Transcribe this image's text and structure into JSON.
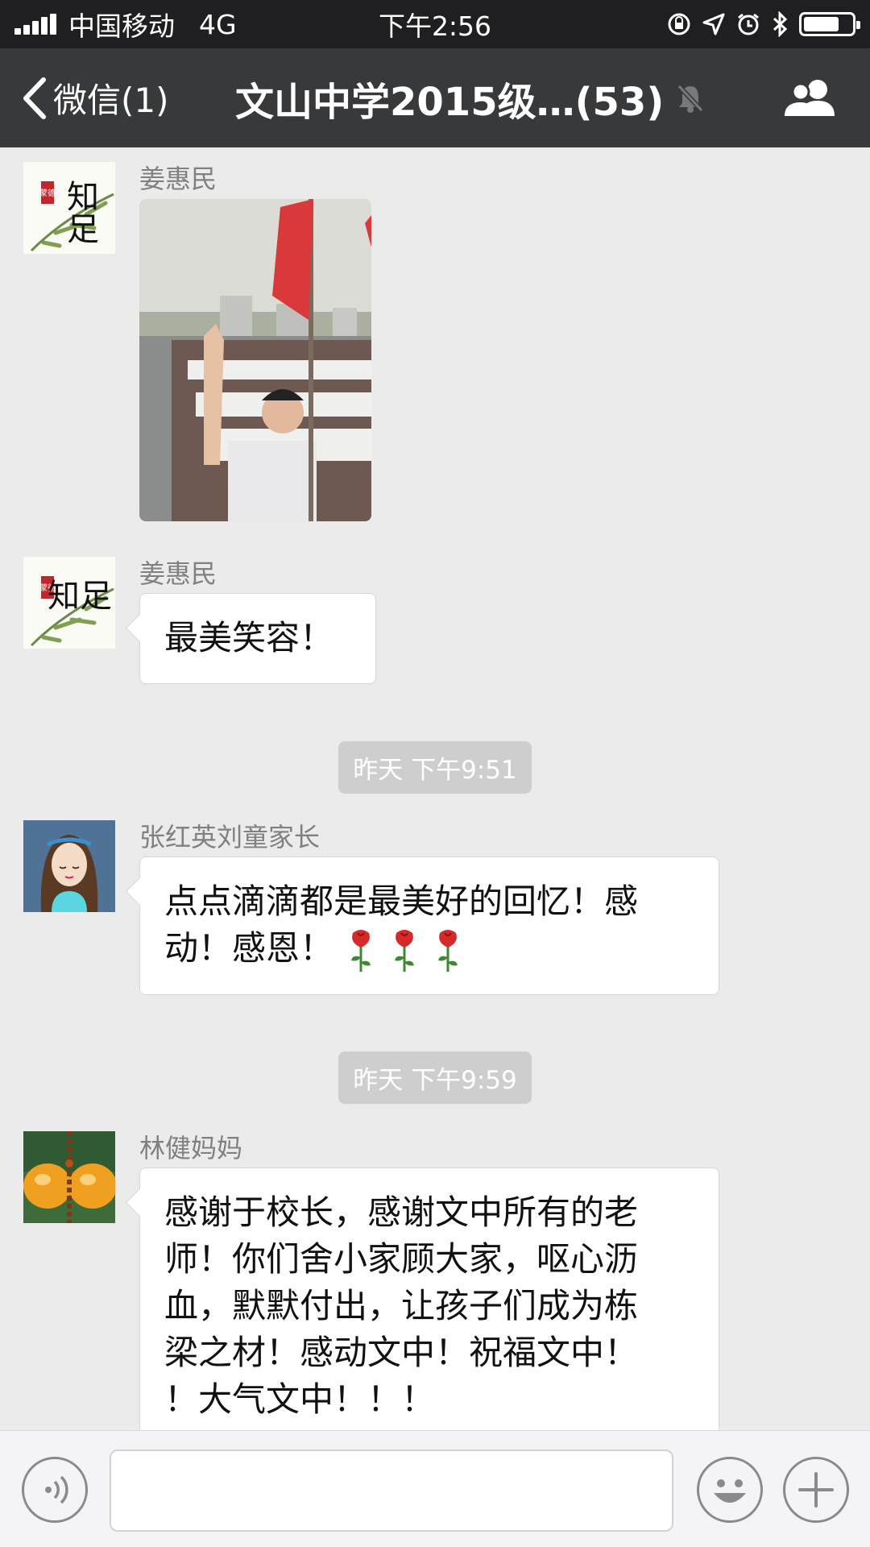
{
  "status_bar": {
    "carrier": "中国移动",
    "network": "4G",
    "time": "下午2:56",
    "icons": [
      "orientation-lock-icon",
      "location-icon",
      "alarm-icon",
      "bluetooth-icon",
      "battery-icon"
    ]
  },
  "nav": {
    "back_label": "微信(1)",
    "title": "文山中学2015级…(53)",
    "icons": [
      "back-chevron-icon",
      "mute-bell-icon",
      "group-members-icon"
    ]
  },
  "messages": [
    {
      "sender": "姜惠民",
      "type": "image",
      "image": "student-thumbs-up-with-red-flag-photo"
    },
    {
      "sender": "姜惠民",
      "type": "text",
      "text": "最美笑容！"
    },
    {
      "type": "timestamp",
      "text": "昨天 下午9:51"
    },
    {
      "sender": "张红英刘童家长",
      "type": "text",
      "lines": [
        "点点滴滴都是最美好的回忆！感",
        "动！感恩！"
      ],
      "emoji": [
        "rose",
        "rose",
        "rose"
      ]
    },
    {
      "type": "timestamp",
      "text": "昨天 下午9:59"
    },
    {
      "sender": "林健妈妈",
      "type": "text",
      "lines": [
        "感谢于校长，感谢文中所有的老",
        "师！你们舍小家顾大家，呕心沥",
        "血，默默付出，让孩子们成为栋",
        "梁之材！感动文中！祝福文中！",
        "！大气文中！！！"
      ]
    }
  ],
  "avatars": {
    "jiang": {
      "text": "知足",
      "seal": "蒙德"
    },
    "zhang": "girl-cartoon-avatar",
    "lin": "orange-gourd-avatar"
  },
  "input_bar": {
    "icons": [
      "voice-icon",
      "emoji-icon",
      "plus-icon"
    ]
  },
  "colors": {
    "status_bg": "#1f1f21",
    "nav_bg": "#38393b",
    "chat_bg": "#ebebeb",
    "bubble_bg": "#ffffff",
    "timestamp_bg": "#cecece"
  }
}
